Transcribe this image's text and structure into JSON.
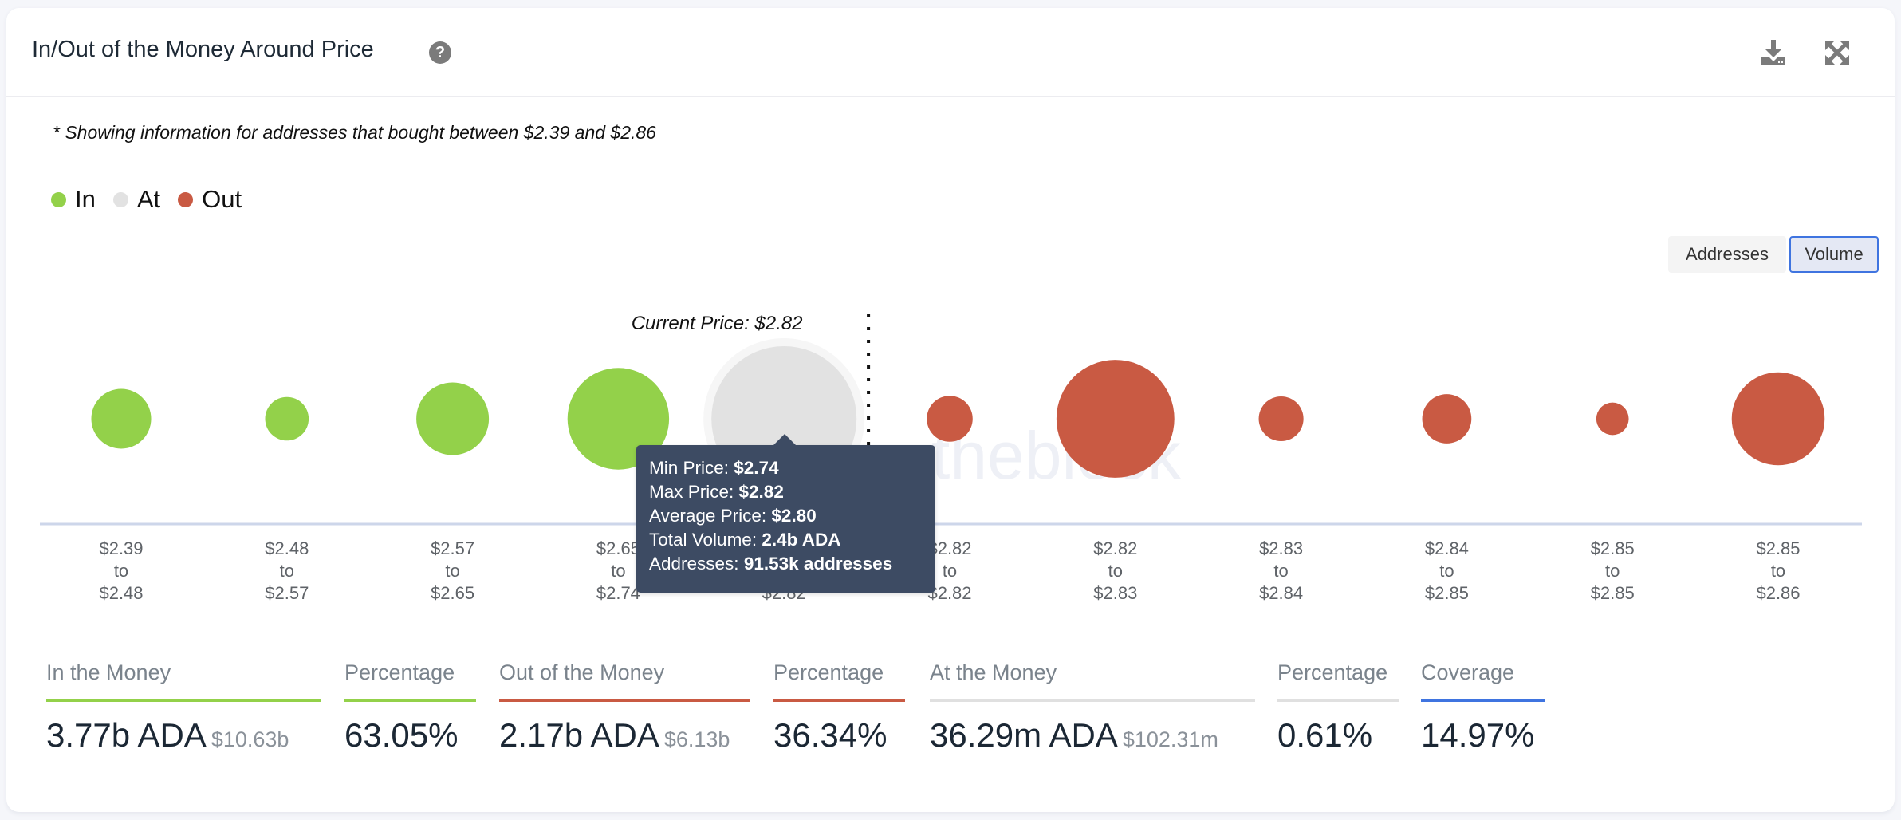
{
  "header": {
    "title": "In/Out of the Money Around Price",
    "help_icon": "question-circle-icon",
    "download_icon": "download-icon",
    "expand_icon": "expand-arrows-icon"
  },
  "note": "* Showing information for addresses that bought between $2.39 and $2.86",
  "legend": [
    {
      "label": "In",
      "color": "#93d14a"
    },
    {
      "label": "At",
      "color": "#e2e2e2"
    },
    {
      "label": "Out",
      "color": "#c95a43"
    }
  ],
  "toggle": {
    "options": [
      "Addresses",
      "Volume"
    ],
    "selected": "Volume"
  },
  "tooltip": {
    "min_label": "Min Price: ",
    "min_value": "$2.74",
    "max_label": "Max Price: ",
    "max_value": "$2.82",
    "avg_label": "Average Price: ",
    "avg_value": "$2.80",
    "vol_label": "Total Volume: ",
    "vol_value": "2.4b ADA",
    "addr_label": "Addresses: ",
    "addr_value": "91.53k addresses"
  },
  "watermark": "theblock",
  "chart_data": {
    "type": "scatter",
    "subtype": "bubble",
    "title": "In/Out of the Money Around Price",
    "current_price_label": "Current Price: $2.82",
    "current_price": 2.82,
    "size_metric": "Volume",
    "categories": [
      {
        "from": "$2.39",
        "to": "$2.48"
      },
      {
        "from": "$2.48",
        "to": "$2.57"
      },
      {
        "from": "$2.57",
        "to": "$2.65"
      },
      {
        "from": "$2.65",
        "to": "$2.74"
      },
      {
        "from": "$2.74",
        "to": "$2.82"
      },
      {
        "from": "$2.82",
        "to": "$2.82"
      },
      {
        "from": "$2.82",
        "to": "$2.83"
      },
      {
        "from": "$2.83",
        "to": "$2.84"
      },
      {
        "from": "$2.84",
        "to": "$2.85"
      },
      {
        "from": "$2.85",
        "to": "$2.85"
      },
      {
        "from": "$2.85",
        "to": "$2.86"
      }
    ],
    "range_connector": "to",
    "status": [
      "In",
      "In",
      "In",
      "In",
      "At",
      "Out",
      "Out",
      "Out",
      "Out",
      "Out",
      "Out"
    ],
    "relative_volume": [
      0.17,
      0.09,
      0.25,
      0.49,
      1.0,
      0.1,
      0.66,
      0.095,
      0.115,
      0.05,
      0.41
    ],
    "highlighted_index": 4,
    "legend": [
      "In",
      "At",
      "Out"
    ],
    "legend_position": "top-left",
    "grid": false,
    "colors": {
      "In": "#93d14a",
      "At": "#e2e2e2",
      "Out": "#c95a43",
      "axis": "#cdd6ea"
    }
  },
  "stats": [
    {
      "label": "In the Money",
      "value": "3.77b ADA",
      "sub": "$10.63b",
      "color": "#93d14a"
    },
    {
      "label": "Percentage",
      "value": "63.05%",
      "sub": "",
      "color": "#93d14a"
    },
    {
      "label": "Out of the Money",
      "value": "2.17b ADA",
      "sub": "$6.13b",
      "color": "#c95a43"
    },
    {
      "label": "Percentage",
      "value": "36.34%",
      "sub": "",
      "color": "#c95a43"
    },
    {
      "label": "At the Money",
      "value": "36.29m ADA",
      "sub": "$102.31m",
      "color": "#e0e0e0"
    },
    {
      "label": "Percentage",
      "value": "0.61%",
      "sub": "",
      "color": "#e0e0e0"
    },
    {
      "label": "Coverage",
      "value": "14.97%",
      "sub": "",
      "color": "#3f74e0"
    }
  ]
}
